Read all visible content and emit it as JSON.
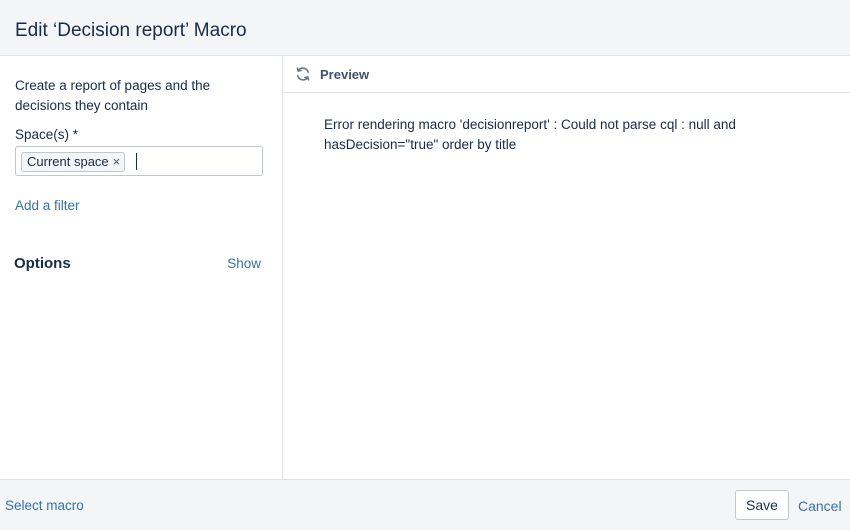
{
  "header": {
    "title": "Edit ‘Decision report’ Macro"
  },
  "left_pane": {
    "description": "Create a report of pages and the decisions they contain",
    "spaces_label": "Space(s) *",
    "spaces_tokens": [
      {
        "label": "Current space",
        "remove_glyph": "×"
      }
    ],
    "add_filter_label": "Add a filter",
    "options_title": "Options",
    "options_toggle_label": "Show"
  },
  "preview": {
    "icon": "refresh-icon",
    "label": "Preview",
    "error_message": "Error rendering macro 'decisionreport' : Could not parse cql : null and hasDecision=\"true\" order by title"
  },
  "footer": {
    "select_macro_label": "Select macro",
    "save_label": "Save",
    "cancel_label": "Cancel"
  },
  "colors": {
    "link": "#3572b0",
    "text": "#172b4d",
    "header_bg": "#f4f5f7",
    "border": "#dfe1e6"
  }
}
